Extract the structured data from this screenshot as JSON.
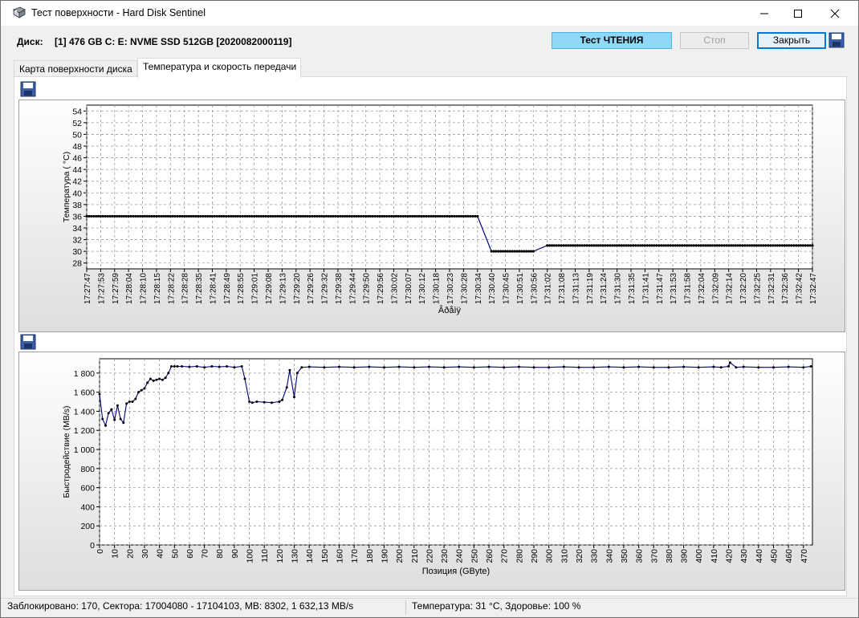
{
  "window": {
    "title": "Тест поверхности - Hard Disk Sentinel",
    "controls": {
      "minimize": "—",
      "maximize": "☐",
      "close": "✕"
    }
  },
  "disk": {
    "label": "Диск:",
    "value": "[1] 476 GB C: E: NVME SSD 512GB [2020082000119]"
  },
  "buttons": {
    "read_test": "Тест ЧТЕНИЯ",
    "stop": "Стоп",
    "close": "Закрыть"
  },
  "tabs": [
    {
      "label": "Карта поверхности диска",
      "active": false
    },
    {
      "label": "Температура и скорость передачи",
      "active": true
    }
  ],
  "status": {
    "left": "Заблокировано: 170, Сектора: 17004080 - 17104103, MB: 8302, 1 632,13 MB/s",
    "right": "Температура: 31  °C,  Здоровье: 100 %"
  },
  "colors": {
    "series": "#000080",
    "grid": "#9a9a9a",
    "read_button": "#8fd8f8"
  },
  "chart_data": [
    {
      "type": "line",
      "ylabel": "Температура ( °C)",
      "xlabel": "Âðåìÿ",
      "ylim": [
        27,
        55
      ],
      "yticks": [
        28,
        30,
        32,
        34,
        36,
        38,
        40,
        42,
        44,
        46,
        48,
        50,
        52,
        54
      ],
      "x": [
        "17:27:47",
        "17:27:53",
        "17:27:59",
        "17:28:04",
        "17:28:10",
        "17:28:15",
        "17:28:22",
        "17:28:28",
        "17:28:35",
        "17:28:41",
        "17:28:49",
        "17:28:55",
        "17:29:01",
        "17:29:08",
        "17:29:13",
        "17:29:20",
        "17:29:26",
        "17:29:32",
        "17:29:38",
        "17:29:44",
        "17:29:50",
        "17:29:56",
        "17:30:02",
        "17:30:07",
        "17:30:12",
        "17:30:18",
        "17:30:23",
        "17:30:28",
        "17:30:34",
        "17:30:40",
        "17:30:45",
        "17:30:51",
        "17:30:56",
        "17:31:02",
        "17:31:08",
        "17:31:13",
        "17:31:19",
        "17:31:24",
        "17:31:30",
        "17:31:35",
        "17:31:41",
        "17:31:47",
        "17:31:53",
        "17:31:58",
        "17:32:04",
        "17:32:09",
        "17:32:14",
        "17:32:20",
        "17:32:25",
        "17:32:31",
        "17:32:36",
        "17:32:42",
        "17:32:47"
      ],
      "series": [
        {
          "values": [
            36,
            36,
            36,
            36,
            36,
            36,
            36,
            36,
            36,
            36,
            36,
            36,
            36,
            36,
            36,
            36,
            36,
            36,
            36,
            36,
            36,
            36,
            36,
            36,
            36,
            36,
            36,
            36,
            36,
            30,
            30,
            30,
            30,
            31,
            31,
            31,
            31,
            31,
            31,
            31,
            31,
            31,
            31,
            31,
            31,
            31,
            31,
            31,
            31,
            31,
            31,
            31,
            31
          ]
        }
      ],
      "grid": true
    },
    {
      "type": "line",
      "ylabel": "Быстродействие (MB/s)",
      "xlabel": "Позиция (GByte)",
      "xlim": [
        0,
        476
      ],
      "ylim": [
        0,
        1950
      ],
      "yticks": [
        0,
        200,
        400,
        600,
        800,
        1000,
        1200,
        1400,
        1600,
        1800
      ],
      "ytick_labels": [
        "0",
        "200",
        "400",
        "600",
        "800",
        "1 000",
        "1 200",
        "1 400",
        "1 600",
        "1 800"
      ],
      "xticks": [
        0,
        10,
        20,
        30,
        40,
        50,
        60,
        70,
        80,
        90,
        100,
        110,
        120,
        130,
        140,
        150,
        160,
        170,
        180,
        190,
        200,
        210,
        220,
        230,
        240,
        250,
        260,
        270,
        280,
        290,
        300,
        310,
        320,
        330,
        340,
        350,
        360,
        370,
        380,
        390,
        400,
        410,
        420,
        430,
        440,
        450,
        460,
        470
      ],
      "series": [
        {
          "x": [
            0,
            2,
            4,
            6,
            8,
            10,
            12,
            14,
            16,
            18,
            20,
            22,
            24,
            26,
            28,
            30,
            32,
            34,
            36,
            38,
            40,
            42,
            44,
            46,
            48,
            50,
            52,
            55,
            60,
            65,
            70,
            75,
            80,
            85,
            90,
            95,
            97,
            100,
            102,
            105,
            110,
            115,
            120,
            122,
            125,
            127,
            130,
            132,
            135,
            140,
            150,
            160,
            170,
            180,
            190,
            200,
            210,
            220,
            230,
            240,
            250,
            260,
            270,
            280,
            290,
            300,
            310,
            320,
            330,
            340,
            350,
            360,
            370,
            380,
            390,
            400,
            410,
            415,
            420,
            421,
            425,
            430,
            440,
            450,
            460,
            470,
            475
          ],
          "y": [
            1580,
            1320,
            1250,
            1380,
            1420,
            1310,
            1460,
            1320,
            1280,
            1480,
            1500,
            1500,
            1530,
            1600,
            1620,
            1640,
            1700,
            1740,
            1720,
            1730,
            1740,
            1730,
            1750,
            1800,
            1870,
            1870,
            1870,
            1870,
            1865,
            1870,
            1860,
            1870,
            1865,
            1870,
            1860,
            1870,
            1740,
            1500,
            1490,
            1500,
            1495,
            1490,
            1500,
            1520,
            1650,
            1830,
            1550,
            1800,
            1860,
            1865,
            1860,
            1865,
            1860,
            1865,
            1860,
            1865,
            1860,
            1865,
            1860,
            1865,
            1860,
            1865,
            1860,
            1865,
            1860,
            1860,
            1865,
            1860,
            1860,
            1865,
            1860,
            1865,
            1860,
            1860,
            1865,
            1860,
            1865,
            1860,
            1870,
            1910,
            1860,
            1865,
            1860,
            1860,
            1865,
            1860,
            1870
          ]
        }
      ],
      "grid": true
    }
  ]
}
